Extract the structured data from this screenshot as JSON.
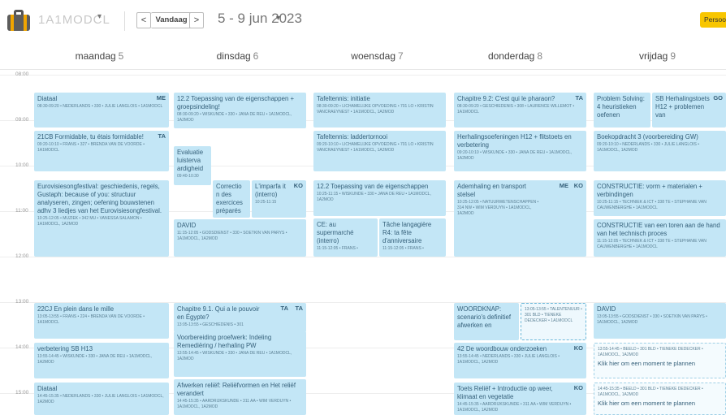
{
  "header": {
    "class_name": "1A1MODCL",
    "today_label": "Vandaag",
    "prev_label": "<",
    "next_label": ">",
    "date_range": "5 - 9 jun 2023",
    "persons_label": "Persoo",
    "dropdown_glyph": "▾"
  },
  "days": [
    {
      "name": "maandag",
      "num": "5"
    },
    {
      "name": "dinsdag",
      "num": "6"
    },
    {
      "name": "woensdag",
      "num": "7"
    },
    {
      "name": "donderdag",
      "num": "8"
    },
    {
      "name": "vrijdag",
      "num": "9"
    }
  ],
  "times": [
    "08:00",
    "09:00",
    "10:00",
    "11:00",
    "12:00",
    "13:00",
    "14:00",
    "15:00"
  ],
  "events": {
    "mon1": {
      "title": "Diataal",
      "meta": "08:30-09:20 • NEDERLANDS • 330 • JULIE LANGLOIS • 1A1MODCL",
      "tag": "ME"
    },
    "mon2": {
      "title": "21CB Formidable, tu étais formidable!",
      "meta": "09:20-10:10 • FRANS • 327 • BRENDA VAN DE VOORDE • 1A1MODCL",
      "tag": "TA"
    },
    "mon3": {
      "title": "Eurovisiesongfestival: geschiedenis, regels, Gustaph: because of you: structuur analyseren, zingen; oefening bouwstenen adhv 3 liedjes van het Eurovisiesongfestival.",
      "meta": "10:25-12:05 • MUZIEK • 342 MU • VANESSA SALAMON • 1A1MODCL, 1A2MOD"
    },
    "mon4": {
      "title": "22CJ En plein dans le mille",
      "meta": "13:05-13:55 • FRANS • 224 • BRENDA VAN DE VOORDE • 1A1MODCL"
    },
    "mon5": {
      "title": "verbetering SB H13",
      "meta": "13:55-14:45 • WISKUNDE • 330 • JANA DE REU • 1A1MODCL, 1A2MOD"
    },
    "mon6": {
      "title": "Diataal",
      "meta": "14:45-15:35 • NEDERLANDS • 330 • JULIE LANGLOIS • 1A1MODCL, 1A2MOD"
    },
    "tue1": {
      "title": "12.2 Toepassing van de eigenschappen + groepsindeling!",
      "meta": "08:30-09:20 • WISKUNDE • 330 • JANA DE REU • 1A1MODCL, 1A2MOD"
    },
    "tue2": {
      "title": "Evaluatie luisterva ardigheid",
      "meta": "09:40-10:30"
    },
    "tue3": {
      "title": "Correctio n des exercices préparés",
      "meta": ""
    },
    "tue4": {
      "title": "L'imparfa it (interro)",
      "meta": "10:25-11:15",
      "tag": "KO"
    },
    "tue5": {
      "title": "DAVID",
      "meta": "11:15-12:05 • GODSDIENST • 330 • SOETKIN VAN PARYS • 1A1MODCL, 1A2MOD"
    },
    "tue6": {
      "title": "Chapitre 9.1. Qui a le pouvoir en Égypte?",
      "meta": "13:05-13:55 • GESCHIEDENIS • 301",
      "tag": "TA",
      "tag2": "TA"
    },
    "tue7": {
      "title": "Voorbereiding proefwerk: Indeling Remediëring / herhaling PW",
      "meta": "13:55-14:45 • WISKUNDE • 330 • JANA DE REU • 1A1MODCL, 1A2MOD"
    },
    "tue8": {
      "title": "Afwerken reliëf: Reliëfvormen en Het reliëf verandert",
      "meta": "14:45-15:35 • AARDRIJKSKUNDE • 311 AA • WIM VERDUYN • 1A1MODCL, 1A2MOD"
    },
    "wed1": {
      "title": "Tafeltennis: initiatie",
      "meta": "08:30-09:20 • LICHAMELIJKE OPVOEDING • 701 LO • KRISTIN VANCRAEYNEST • 1A1MODCL, 1A2MOD"
    },
    "wed2": {
      "title": "Tafeltennis: laddertornooi",
      "meta": "09:20-10:10 • LICHAMELIJKE OPVOEDING • 701 LO • KRISTIN VANCRAEYNEST • 1A1MODCL, 1A2MOD"
    },
    "wed3": {
      "title": "12.2 Toepassing van de eigenschappen",
      "meta": "10:25-11:15 • WISKUNDE • 330 • JANA DE REU • 1A1MODCL, 1A2MOD"
    },
    "wed4": {
      "title": "CE: au supermarché (interro)",
      "meta": "11:15-12:05 • FRANS •"
    },
    "wed5": {
      "title": "Tâche langagière R4: ta fête d'anniversaire",
      "meta": "11:15-12:05 • FRANS •"
    },
    "thu1": {
      "title": "Chapitre 9.2: C'est qui le pharaon?",
      "meta": "08:30-09:20 • GESCHIEDENIS • 308 • LAURENCE WILLEMOT • 1A1MODCL",
      "tag": "TA"
    },
    "thu2": {
      "title": "Herhalingsoefeningen H12 + flitstoets en verbetering",
      "meta": "09:20-10:10 • WISKUNDE • 330 • JANA DE REU • 1A1MODCL, 1A2MOD"
    },
    "thu3": {
      "title": "Ademhaling en transport stelsel",
      "meta": "10:25-12:05 • NATUURWETENSCHAPPEN • 314 NW • WIM VERDUYN • 1A1MODCL, 1A2MOD",
      "tag": "ME",
      "tag2": "KO"
    },
    "thu4": {
      "title": "WOORDKNAP: scenario's definitief afwerken en",
      "meta": ""
    },
    "thu5": {
      "title": "",
      "meta": "13:05-13:55 • TALENTENUUR • 301 BLD • TIENEKE DEDECKER • 1A1MODCL"
    },
    "thu6": {
      "title": "42 De woordbouw onderzoeken",
      "meta": "13:55-14:45 • NEDERLANDS • 330 • JULIE LANGLOIS • 1A1MODCL, 1A2MOD",
      "tag": "KO"
    },
    "thu7": {
      "title": "Toets Reliëf + Introductie op weer, klimaat en vegetatie",
      "meta": "14:45-15:35 • AARDRIJKSKUNDE • 311 AA • WIM VERDUYN • 1A1MODCL, 1A2MOD",
      "tag": "KO"
    },
    "fri1": {
      "title": "Problem Solving: 4 heuristieken oefenen",
      "meta": ""
    },
    "fri2": {
      "title": "SB Herhalingstoets H12 + problemen van",
      "meta": "",
      "tag": "GO"
    },
    "fri3": {
      "title": "Boekopdracht 3 (voorbereiding GW)",
      "meta": "09:20-10:10 • NEDERLANDS • 330 • JULIE LANGLOIS • 1A1MODCL, 1A2MOD"
    },
    "fri4": {
      "title": "CONSTRUCTIE: vorm + materialen + verbindingen",
      "meta": "10:25-11:15 • TECHNIEK & ICT • 338 TE • STEPHANIE VAN CAUWENBERGHE • 1A1MODCL"
    },
    "fri5": {
      "title": "CONSTRUCTIE van een toren aan de hand van het technisch proces",
      "meta": "11:15-12:05 • TECHNIEK & ICT • 338 TE • STEPHANIE VAN CAUWENBERGHE • 1A1MODCL"
    },
    "fri6": {
      "title": "DAVID",
      "meta": "13:05-13:55 • GODSDIENST • 330 • SOETKIN VAN PARYS • 1A1MODCL, 1A2MOD"
    },
    "fri7": {
      "title": "",
      "meta": "13:55-14:45 • BEELD • 301 BLD • TIENEKE DEDECKER • 1A1MODCL, 1A2MOD",
      "link": "Klik hier om een moment te plannen"
    },
    "fri8": {
      "title": "",
      "meta": "14:45-15:35 • BEELD • 301 BLD • TIENEKE DEDECKER • 1A1MODCL, 1A2MOD",
      "link": "Klik hier om een moment te plannen"
    }
  }
}
